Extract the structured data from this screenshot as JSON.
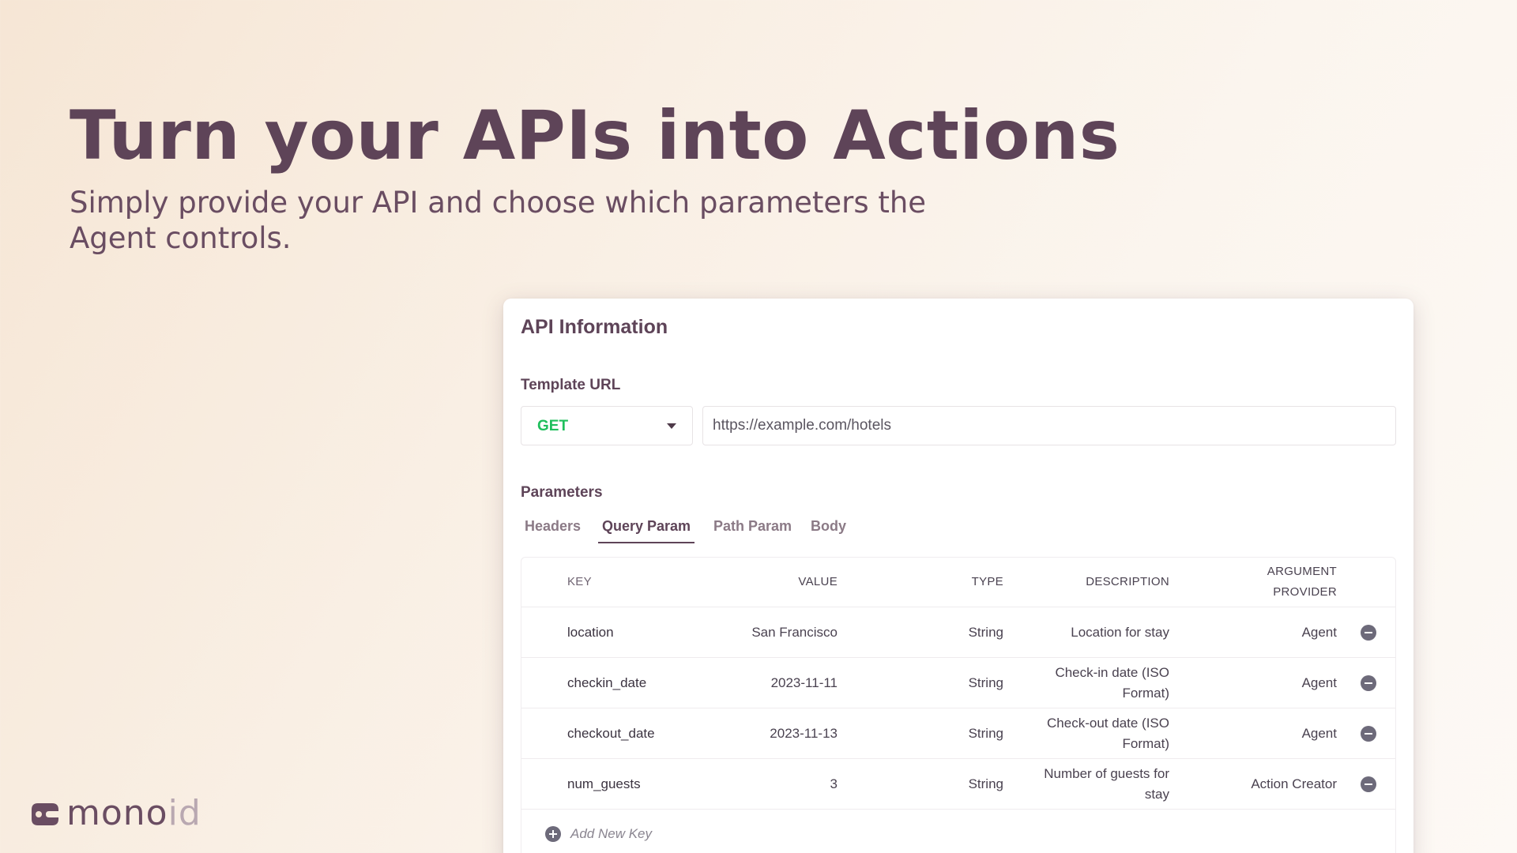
{
  "hero": {
    "title": "Turn your APIs into Actions",
    "subtitle": "Simply provide your API and choose which parameters the Agent controls."
  },
  "card": {
    "title": "API Information",
    "template_url_label": "Template URL",
    "method": "GET",
    "url": "https://example.com/hotels",
    "parameters_label": "Parameters",
    "tabs": [
      {
        "label": "Headers",
        "active": false
      },
      {
        "label": "Query Param",
        "active": true
      },
      {
        "label": "Path Param",
        "active": false
      },
      {
        "label": "Body",
        "active": false
      }
    ],
    "table": {
      "headers": {
        "key": "KEY",
        "value": "VALUE",
        "type": "TYPE",
        "description": "DESCRIPTION",
        "provider": "ARGUMENT PROVIDER"
      },
      "rows": [
        {
          "key": "location",
          "value": "San Francisco",
          "type": "String",
          "description": "Location for stay",
          "provider": "Agent"
        },
        {
          "key": "checkin_date",
          "value": "2023-11-11",
          "type": "String",
          "description": "Check-in date (ISO Format)",
          "provider": "Agent"
        },
        {
          "key": "checkout_date",
          "value": "2023-11-13",
          "type": "String",
          "description": "Check-out date (ISO Format)",
          "provider": "Agent"
        },
        {
          "key": "num_guests",
          "value": "3",
          "type": "String",
          "description": "Number of guests for stay",
          "provider": "Action Creator"
        }
      ],
      "add_label": "Add New Key"
    }
  },
  "logo": {
    "text_main": "mono",
    "text_light": "id",
    "icon": "monoid-logo-mark"
  },
  "colors": {
    "primary": "#5e4458",
    "method_get": "#1fbf5c",
    "icon_gray": "#6d6a7a"
  }
}
